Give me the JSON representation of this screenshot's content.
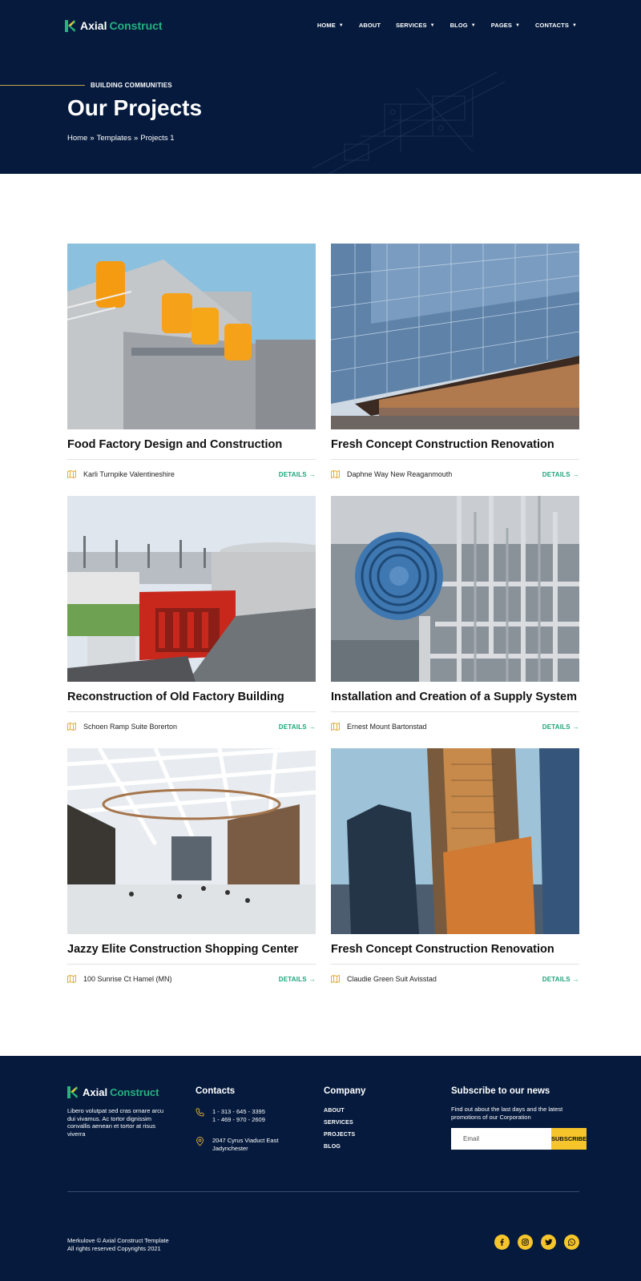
{
  "brand": {
    "name_part1": "Axial",
    "name_part2": "Construct",
    "accent": "#25b47e",
    "dark_bg": "#051a3d",
    "yellow": "#f6c52b"
  },
  "nav": {
    "items": [
      {
        "label": "HOME",
        "has_caret": true
      },
      {
        "label": "ABOUT",
        "has_caret": false
      },
      {
        "label": "SERVICES",
        "has_caret": true
      },
      {
        "label": "BLOG",
        "has_caret": true
      },
      {
        "label": "PAGES",
        "has_caret": true
      },
      {
        "label": "CONTACTS",
        "has_caret": true
      }
    ]
  },
  "hero": {
    "eyebrow": "BUILDING COMMUNITIES",
    "title": "Our Projects",
    "breadcrumb": {
      "home": "Home",
      "sep1": "»",
      "templates": "Templates",
      "sep2": "»",
      "current": "Projects 1"
    }
  },
  "projects": [
    {
      "title": "Food Factory Design and Construction",
      "location": "Karli Turnpike Valentineshire",
      "details": "DETAILS",
      "image": "factory-tanks-photo"
    },
    {
      "title": "Fresh Concept Construction Renovation",
      "location": "Daphne Way New Reaganmouth",
      "details": "DETAILS",
      "image": "glass-building-photo"
    },
    {
      "title": "Reconstruction of Old Factory Building",
      "location": "Schoen Ramp Suite Borerton",
      "details": "DETAILS",
      "image": "refinery-photo"
    },
    {
      "title": "Installation and Creation of a Supply System",
      "location": "Ernest Mount Bartonstad",
      "details": "DETAILS",
      "image": "pipes-photo"
    },
    {
      "title": "Jazzy Elite Construction Shopping Center",
      "location": "100 Sunrise Ct Hamel (MN)",
      "details": "DETAILS",
      "image": "mall-atrium-photo"
    },
    {
      "title": "Fresh Concept Construction Renovation",
      "location": "Claudie Green Suit Avisstad",
      "details": "DETAILS",
      "image": "skyscrapers-photo"
    }
  ],
  "footer": {
    "description": "Libero volutpat sed cras ornare arcu dui vivamus. Ac tortor dignissim convallis aenean et tortor at risus viverra",
    "contacts": {
      "heading": "Contacts",
      "phone1": "1 - 313 - 645 - 3395",
      "phone2": "1 - 469 - 970 - 2609",
      "address1": "2047 Cyrus Viaduct East",
      "address2": "Jadynchester"
    },
    "company": {
      "heading": "Company",
      "links": [
        "ABOUT",
        "SERVICES",
        "PROJECTS",
        "BLOG"
      ]
    },
    "subscribe": {
      "heading": "Subscribe to our news",
      "description": "Find out about the last days and the latest promotions of our Corporation",
      "placeholder": "Email",
      "button": "SUBSCRIBE"
    },
    "copyright1": "Merkulove © Axial Construct Template",
    "copyright2": "All rights reserved Copyrights 2021",
    "social": [
      "facebook-icon",
      "instagram-icon",
      "twitter-icon",
      "whatsapp-icon"
    ]
  }
}
